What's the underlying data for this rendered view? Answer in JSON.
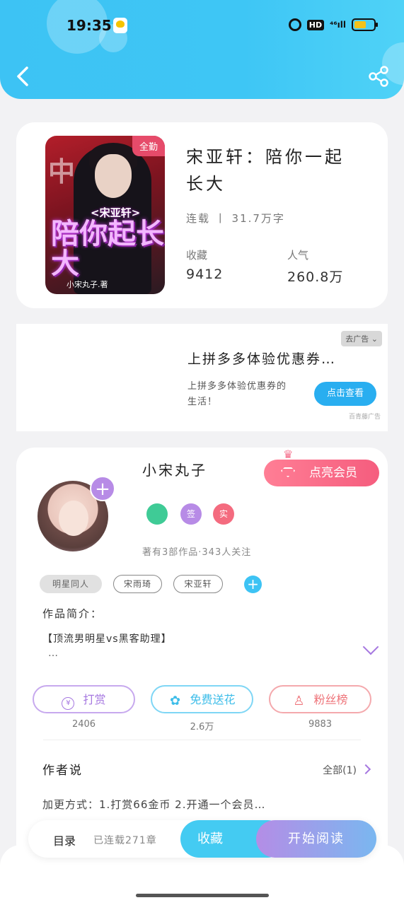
{
  "status_bar": {
    "time": "19:35",
    "hd": "HD",
    "signal": "⁴⁶ıll"
  },
  "book": {
    "title": "宋亚轩：陪你一起长大",
    "status_words": "连载 丨 31.7万字",
    "favorites_label": "收藏",
    "favorites_value": "9412",
    "popularity_label": "人气",
    "popularity_value": "260.8万",
    "cover": {
      "badge": "全勤",
      "bg_text": "中",
      "subtitle": "<宋亚轩>",
      "big_title": "陪你起长大",
      "author": "小宋丸子.著"
    }
  },
  "ad": {
    "close_label": "去广告 ⌄",
    "title": "上拼多多体验优惠券…",
    "desc": "上拼多多体验优惠券的生活！",
    "button": "点击查看",
    "source": "百青藤广告"
  },
  "author": {
    "name": "小宋丸子",
    "vip_button": "点亮会员",
    "badges": [
      {
        "label": "",
        "color": "#3fcb96"
      },
      {
        "label": "签",
        "color": "#b78be6"
      },
      {
        "label": "实",
        "color": "#f46b7f"
      }
    ],
    "info": "著有3部作品·343人关注",
    "tags": [
      "明星同人",
      "宋雨琦",
      "宋亚轩"
    ],
    "intro_label": "作品简介：",
    "intro_text": "【顶流男明星vs黑客助理】",
    "intro_more": "…",
    "actions": [
      {
        "label": "打赏",
        "icon": "¥",
        "count": "2406",
        "color": "#b78be6"
      },
      {
        "label": "免费送花",
        "icon": "✿",
        "count": "2.6万",
        "color": "#3dc3f4"
      },
      {
        "label": "粉丝榜",
        "icon": "♙",
        "count": "9883",
        "color": "#f07a80"
      }
    ],
    "talk_label": "作者说",
    "talk_all": "全部(1)",
    "talk_text": "加更方式：1.打赏66金币 2.开通一个会员…"
  },
  "bottom_bar": {
    "toc": "目录",
    "serial": "已连载271章",
    "favorite": "收藏",
    "read": "开始阅读"
  }
}
